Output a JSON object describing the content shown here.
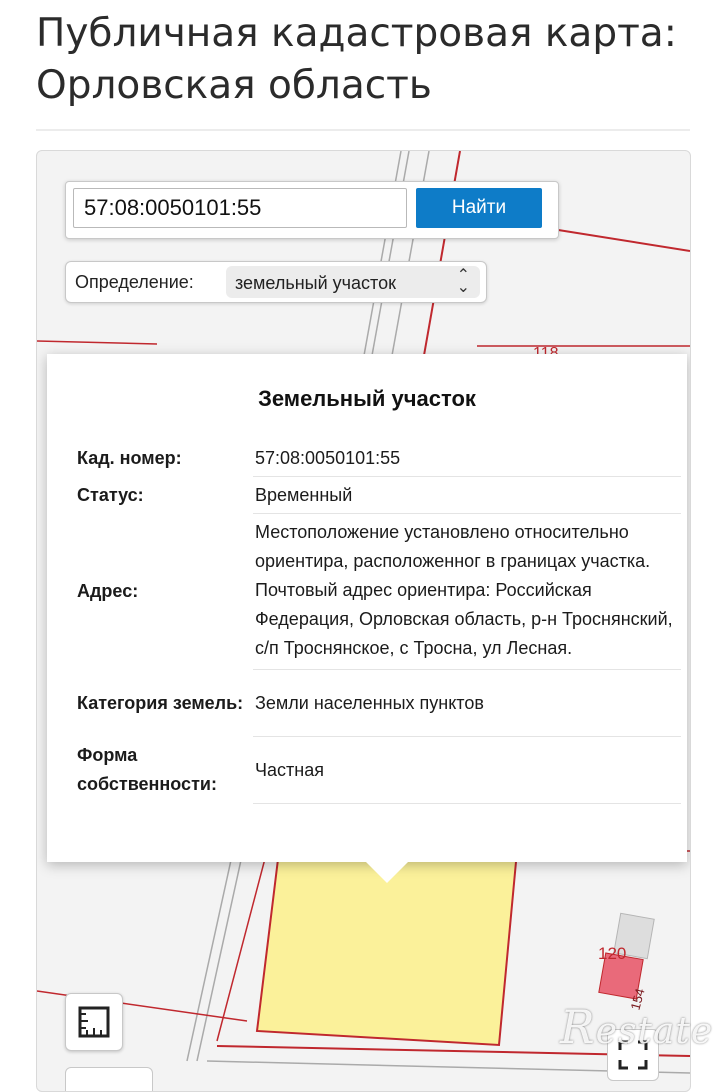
{
  "page": {
    "title": "Публичная кадастровая карта: Орловская область"
  },
  "search": {
    "value": "57:08:0050101:55",
    "button_label": "Найти"
  },
  "object_type": {
    "label": "Определение:",
    "selected": "земельный участок",
    "chevron_icon": "updown-chevron-icon"
  },
  "popup": {
    "title": "Земельный участок",
    "rows": [
      {
        "key": "Кад. номер:",
        "value": "57:08:0050101:55"
      },
      {
        "key": "Статус:",
        "value": "Временный"
      },
      {
        "key": "Адрес:",
        "value": "Местоположение установлено относительно ориентира, расположенног в границах участка. Почтовый адрес ориентира: Российская Федерация, Орловская область, р-н Троснянский, с/п Троснянское, с Тросна, ул Лесная."
      },
      {
        "key": "Категория земель:",
        "value": "Земли населенных пунктов"
      },
      {
        "key": "Форма собственности:",
        "value": "Частная"
      }
    ]
  },
  "map": {
    "labels": {
      "parcel_118": "118",
      "parcel_120": "120",
      "parcel_154": "154"
    },
    "colors": {
      "boundary": "#c0282e",
      "parcel_fill": "#fbf19a",
      "selected_building": "#e96a7a"
    }
  },
  "controls": {
    "ruler_icon": "ruler-icon",
    "fullscreen_icon": "fullscreen-icon"
  },
  "watermark": {
    "text": "Restate"
  }
}
